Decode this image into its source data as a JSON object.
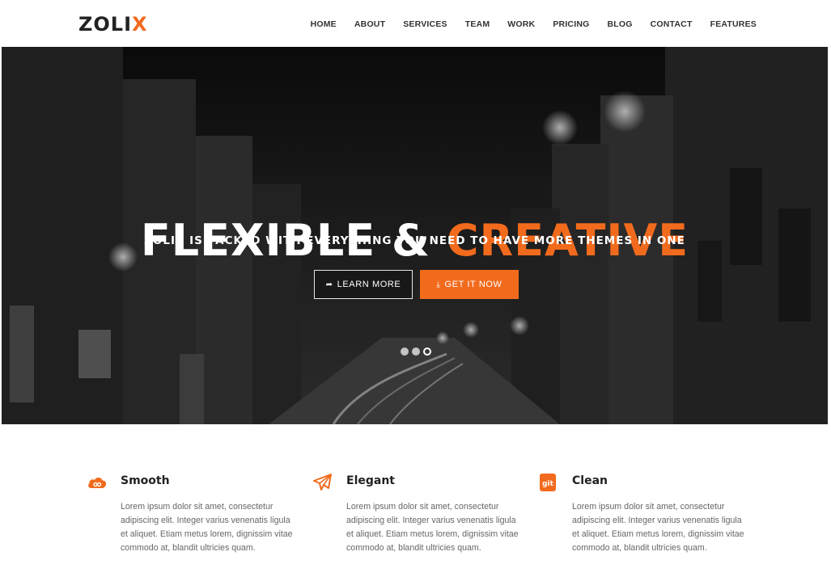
{
  "brand": {
    "logo_main": "ZOLI",
    "logo_accent": "X",
    "accent_color": "#f26b1d"
  },
  "nav": {
    "items": [
      "HOME",
      "ABOUT",
      "SERVICES",
      "TEAM",
      "WORK",
      "PRICING",
      "BLOG",
      "CONTACT",
      "FEATURES"
    ]
  },
  "hero": {
    "title_main": "FLEXIBLE & ",
    "title_accent": "CREATIVE",
    "subtitle": "ZOLIX IS PACKED WITH EVERYTHING YOU NEED TO HAVE MORE THEMES IN ONE",
    "learn_more": "LEARN MORE",
    "learn_more_icon": "share-arrow-icon",
    "get_it_now": "GET IT NOW",
    "get_it_now_icon": "download-icon",
    "slides": {
      "count": 3,
      "active_index": 2
    }
  },
  "features": [
    {
      "icon": "cloud-icon",
      "title": "Smooth",
      "text": "Lorem ipsum dolor sit amet, consectetur adipiscing elit. Integer varius venenatis ligula et aliquet. Etiam metus lorem, dignissim vitae commodo at, blandit ultricies quam."
    },
    {
      "icon": "paper-plane-icon",
      "title": "Elegant",
      "text": "Lorem ipsum dolor sit amet, consectetur adipiscing elit. Integer varius venenatis ligula et aliquet. Etiam metus lorem, dignissim vitae commodo at, blandit ultricies quam."
    },
    {
      "icon": "git-icon",
      "title": "Clean",
      "icon_text": "git",
      "text": "Lorem ipsum dolor sit amet, consectetur adipiscing elit. Integer varius venenatis ligula et aliquet. Etiam metus lorem, dignissim vitae commodo at, blandit ultricies quam."
    }
  ]
}
